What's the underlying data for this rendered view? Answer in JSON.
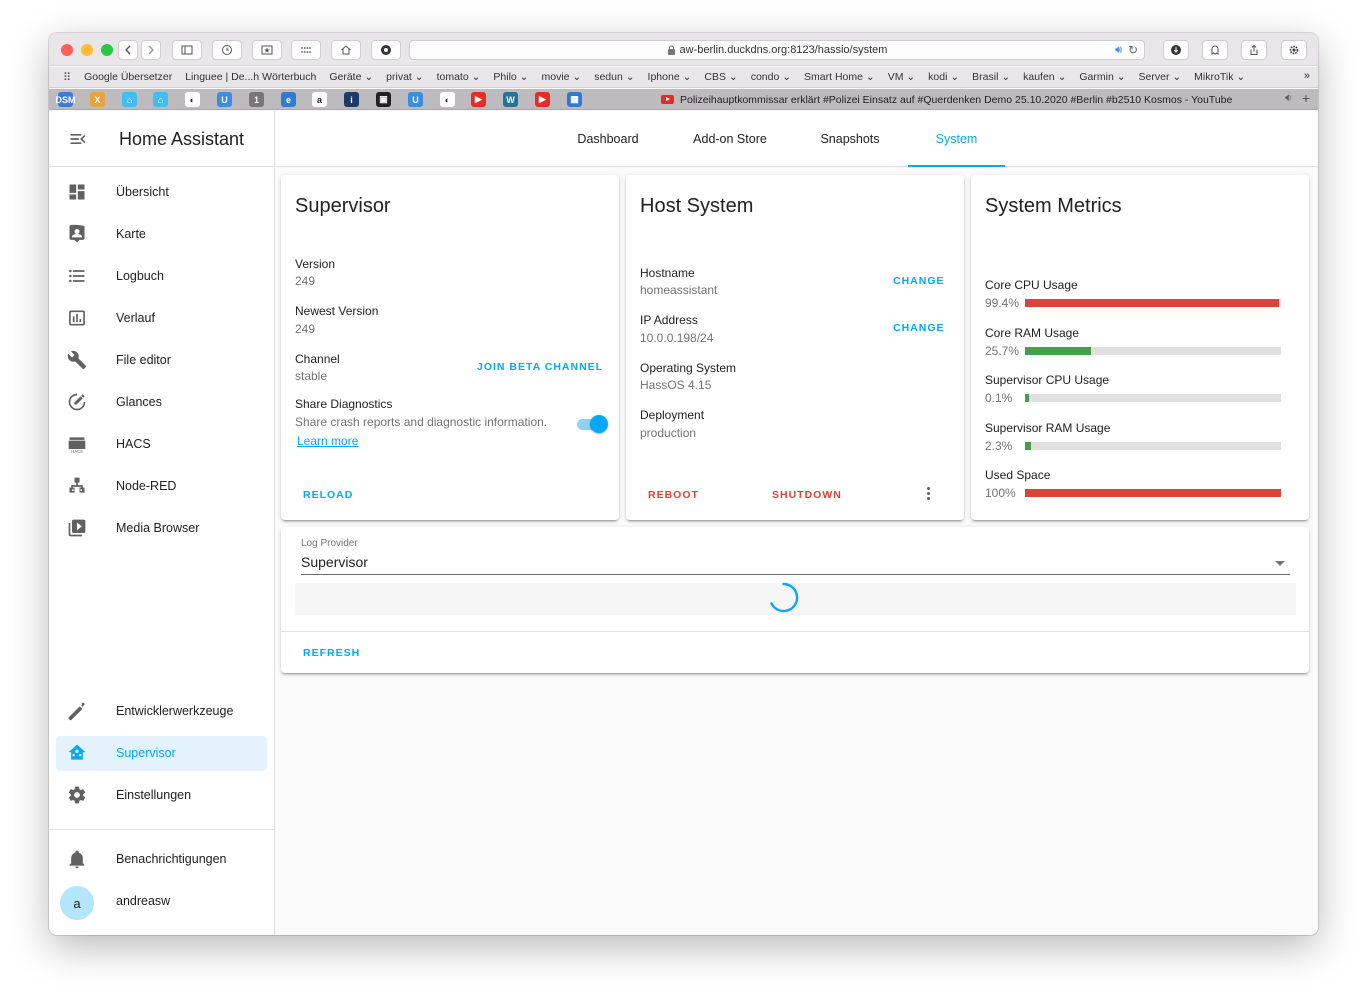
{
  "browser": {
    "url": "aw-berlin.duckdns.org:8123/hassio/system",
    "bookmarks": [
      "Google Übersetzer",
      "Linguee | De...h Wörterbuch",
      "Geräte ⌄",
      "privat ⌄",
      "tomato ⌄",
      "Philo ⌄",
      "movie ⌄",
      "sedun ⌄",
      "Iphone ⌄",
      "CBS ⌄",
      "condo ⌄",
      "Smart Home ⌄",
      "VM ⌄",
      "kodi ⌄",
      "Brasil ⌄",
      "kaufen ⌄",
      "Garmin ⌄",
      "Server ⌄",
      "MikroTik ⌄"
    ],
    "active_tab_title": "Polizeihauptkommissar erklärt #Polizei Einsatz auf #Querdenken Demo 25.10.2020 #Berlin #b2510 Kosmos - YouTube",
    "pinned_tabs": [
      {
        "icon": "dsm-icon",
        "label": "DSM",
        "color": "#3e7bd6"
      },
      {
        "icon": "x-icon",
        "label": "X",
        "color": "#e8a33c"
      },
      {
        "icon": "home-assistant-icon",
        "label": "⌂",
        "color": "#41bdf5"
      },
      {
        "icon": "home-assistant-icon",
        "label": "⌂",
        "color": "#41bdf5"
      },
      {
        "icon": "mikrotik-icon",
        "label": "◐",
        "color": "#ffffff"
      },
      {
        "icon": "u-icon",
        "label": "U",
        "color": "#3a8de0"
      },
      {
        "icon": "one-icon",
        "label": "1",
        "color": "#777777"
      },
      {
        "icon": "edge-icon",
        "label": "e",
        "color": "#2f7ad8"
      },
      {
        "icon": "amazon-icon",
        "label": "a",
        "color": "#ffffff"
      },
      {
        "icon": "info-icon",
        "label": "i",
        "color": "#1e3a68"
      },
      {
        "icon": "radio-icon",
        "label": "▣",
        "color": "#222222"
      },
      {
        "icon": "u-icon",
        "label": "U",
        "color": "#3a8de0"
      },
      {
        "icon": "mikrotik-icon",
        "label": "◐",
        "color": "#ffffff"
      },
      {
        "icon": "youtube-icon",
        "label": "▶",
        "color": "#e52d27"
      },
      {
        "icon": "wordpress-icon",
        "label": "W",
        "color": "#21759b"
      },
      {
        "icon": "youtube-icon",
        "label": "▶",
        "color": "#e52d27"
      },
      {
        "icon": "calendar-icon",
        "label": "▦",
        "color": "#2f7ad8"
      }
    ]
  },
  "sidebar": {
    "title": "Home Assistant",
    "items": [
      {
        "label": "Übersicht",
        "icon": "dashboard-icon"
      },
      {
        "label": "Karte",
        "icon": "map-icon"
      },
      {
        "label": "Logbuch",
        "icon": "logbook-icon"
      },
      {
        "label": "Verlauf",
        "icon": "history-icon"
      },
      {
        "label": "File editor",
        "icon": "wrench-icon"
      },
      {
        "label": "Glances",
        "icon": "gauge-icon"
      },
      {
        "label": "HACS",
        "icon": "hacs-icon"
      },
      {
        "label": "Node-RED",
        "icon": "sitemap-icon"
      },
      {
        "label": "Media Browser",
        "icon": "media-icon"
      }
    ],
    "bottom_items": [
      {
        "label": "Entwicklerwerkzeuge",
        "icon": "hammer-icon"
      },
      {
        "label": "Supervisor",
        "icon": "supervisor-icon",
        "selected": true
      },
      {
        "label": "Einstellungen",
        "icon": "cog-icon"
      }
    ],
    "notifications_label": "Benachrichtigungen",
    "user": {
      "initial": "a",
      "name": "andreasw"
    }
  },
  "tabs": [
    {
      "label": "Dashboard",
      "active": false
    },
    {
      "label": "Add-on Store",
      "active": false
    },
    {
      "label": "Snapshots",
      "active": false
    },
    {
      "label": "System",
      "active": true
    }
  ],
  "supervisor_card": {
    "title": "Supervisor",
    "version_label": "Version",
    "version": "249",
    "newest_label": "Newest Version",
    "newest": "249",
    "channel_label": "Channel",
    "channel": "stable",
    "join_beta": "Join beta channel",
    "diag_label": "Share Diagnostics",
    "diag_desc": "Share crash reports and diagnostic information.",
    "diag_enabled": true,
    "learn_more": "Learn more",
    "reload": "Reload"
  },
  "host_card": {
    "title": "Host System",
    "hostname_label": "Hostname",
    "hostname": "homeassistant",
    "ip_label": "IP Address",
    "ip": "10.0.0.198/24",
    "change": "Change",
    "os_label": "Operating System",
    "os": "HassOS 4.15",
    "deployment_label": "Deployment",
    "deployment": "production",
    "reboot": "Reboot",
    "shutdown": "Shutdown"
  },
  "metrics_card": {
    "title": "System Metrics",
    "metrics": [
      {
        "label": "Core CPU Usage",
        "value": "99.4%",
        "fraction": 0.994,
        "color": "#db4437"
      },
      {
        "label": "Core RAM Usage",
        "value": "25.7%",
        "fraction": 0.257,
        "color": "#43a047"
      },
      {
        "label": "Supervisor CPU Usage",
        "value": "0.1%",
        "fraction": 0.001,
        "color": "#43a047"
      },
      {
        "label": "Supervisor RAM Usage",
        "value": "2.3%",
        "fraction": 0.023,
        "color": "#43a047"
      },
      {
        "label": "Used Space",
        "value": "100%",
        "fraction": 1.0,
        "color": "#db4437"
      }
    ]
  },
  "log_card": {
    "provider_label": "Log Provider",
    "provider": "Supervisor",
    "refresh": "Refresh"
  },
  "colors": {
    "accent": "#03a9f4",
    "danger": "#db4437",
    "ok": "#43a047"
  }
}
